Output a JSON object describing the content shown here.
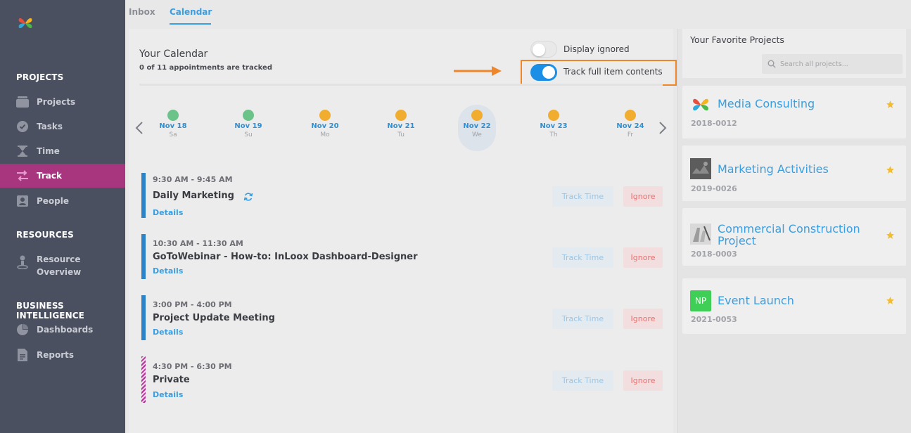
{
  "sidebar": {
    "sections": {
      "projects": "PROJECTS",
      "resources": "RESOURCES",
      "business_intelligence": "BUSINESS INTELLIGENCE"
    },
    "items": {
      "projects": "Projects",
      "tasks": "Tasks",
      "time": "Time",
      "track": "Track",
      "people": "People",
      "resource_overview_line1": "Resource",
      "resource_overview_line2": "Overview",
      "dashboards": "Dashboards",
      "reports": "Reports"
    },
    "active_item": "Track",
    "active_color": "#a8367f"
  },
  "tabs": {
    "inbox": "Inbox",
    "calendar": "Calendar",
    "active": "Calendar"
  },
  "calendar": {
    "title": "Your Calendar",
    "subtitle": "0 of 11 appointments are tracked",
    "display_ignored_label": "Display ignored",
    "display_ignored_on": false,
    "track_full_label": "Track full item contents",
    "track_full_on": true,
    "days": [
      {
        "date": "Nov 18",
        "dow": "Sa",
        "status": "green"
      },
      {
        "date": "Nov 19",
        "dow": "Su",
        "status": "green"
      },
      {
        "date": "Nov 20",
        "dow": "Mo",
        "status": "orange"
      },
      {
        "date": "Nov 21",
        "dow": "Tu",
        "status": "orange"
      },
      {
        "date": "Nov 22",
        "dow": "We",
        "status": "orange",
        "selected": true
      },
      {
        "date": "Nov 23",
        "dow": "Th",
        "status": "orange"
      },
      {
        "date": "Nov 24",
        "dow": "Fr",
        "status": "orange"
      }
    ],
    "appointments": [
      {
        "time": "9:30 AM - 9:45 AM",
        "name": "Daily Marketing",
        "details": "Details",
        "track": "Track Time",
        "ignore": "Ignore"
      },
      {
        "time": "10:30 AM - 11:30 AM",
        "name": "GoToWebinar - How-to: InLoox Dashboard-Designer",
        "details": "Details",
        "track": "Track Time",
        "ignore": "Ignore"
      },
      {
        "time": "3:00 PM - 4:00 PM",
        "name": "Project Update Meeting",
        "details": "Details",
        "track": "Track Time",
        "ignore": "Ignore"
      },
      {
        "time": "4:30 PM - 6:30 PM",
        "name": "Private",
        "details": "Details",
        "track": "Track Time",
        "ignore": "Ignore"
      }
    ]
  },
  "favorites": {
    "title": "Your Favorite Projects",
    "search_placeholder": "Search all projects...",
    "projects": [
      {
        "name": "Media Consulting",
        "number": "2018-0012",
        "icon": "inloox-logo-icon"
      },
      {
        "name": "Marketing Activities",
        "number": "2019-0026",
        "icon": "project-image-icon"
      },
      {
        "name_line1": "Commercial Construction",
        "name_line2": "Project",
        "number": "2018-0003",
        "icon": "project-image-icon"
      },
      {
        "name": "Event Launch",
        "number": "2021-0053",
        "icon": "initials-badge",
        "initials": "NP"
      }
    ]
  },
  "colors": {
    "accent": "#3a9ee0",
    "status_green": "#6cc38a",
    "status_orange": "#f0ad2f",
    "annotation_orange": "#f0862a",
    "star": "#f3bc2e"
  }
}
